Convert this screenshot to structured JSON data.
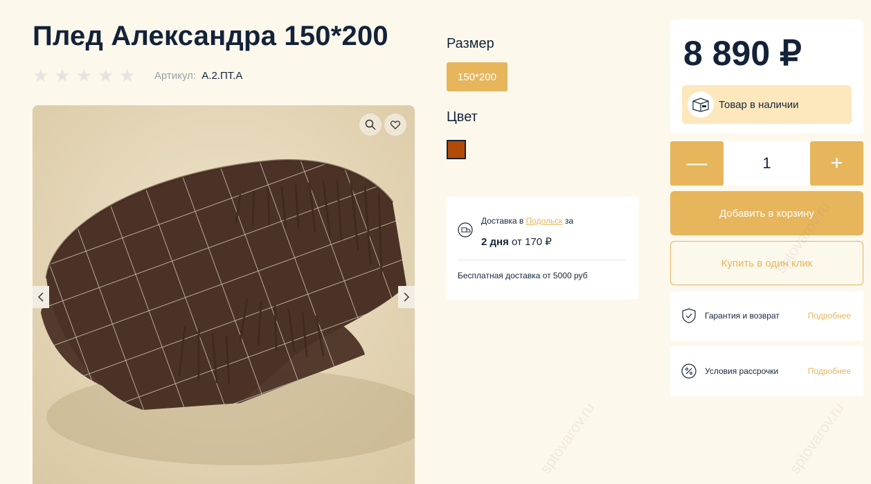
{
  "product": {
    "title": "Плед Александра 150*200",
    "rating_stars": 5,
    "rating_filled": 0,
    "sku_label": "Артикул:",
    "sku_value": "А.2.ПТ.А"
  },
  "gallery": {
    "zoom_icon": "search-icon",
    "favorite_icon": "heart-icon",
    "prev_icon": "chevron-left-icon",
    "next_icon": "chevron-right-icon"
  },
  "options": {
    "size_label": "Размер",
    "size_value": "150*200",
    "color_label": "Цвет",
    "color_value": "#b24b07"
  },
  "delivery": {
    "prefix": "Доставка в",
    "city": "Подольск",
    "suffix": "за",
    "days": "2 дня",
    "from_word": "от",
    "price": "170 ₽",
    "free_text": "Бесплатная доставка от 5000 руб"
  },
  "purchase": {
    "price": "8 890 ₽",
    "stock_text": "Товар в наличии",
    "minus_label": "—",
    "plus_label": "+",
    "quantity": "1",
    "add_to_cart": "Добавить в корзину",
    "buy_one_click": "Купить в один клик"
  },
  "info": {
    "warranty_label": "Гарантия и возврат",
    "warranty_more": "Подробнее",
    "installment_label": "Условия рассрочки",
    "installment_more": "Подробнее"
  },
  "watermark": "sptovarov.ru",
  "colors": {
    "accent": "#e6b55c",
    "background": "#fdf8ec",
    "text": "#15243a",
    "stock_bg": "#fde7bd"
  }
}
